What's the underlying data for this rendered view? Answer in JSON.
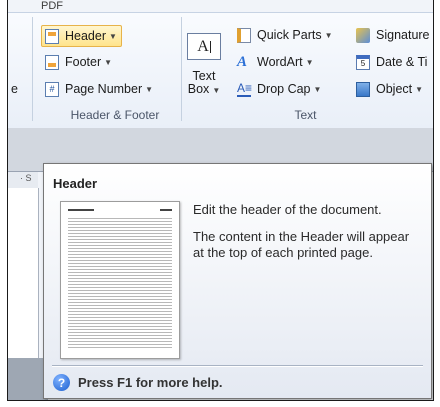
{
  "tabs": {
    "pdf": "PDF"
  },
  "left_cut": {
    "text": "e"
  },
  "header_footer_group": {
    "label": "Header & Footer",
    "header": "Header",
    "footer": "Footer",
    "page_number": "Page Number"
  },
  "text_group": {
    "label": "Text",
    "text_box_line1": "Text",
    "text_box_line2": "Box",
    "quick_parts": "Quick Parts",
    "wordart": "WordArt",
    "drop_cap": "Drop Cap",
    "signature": "Signature",
    "date_time": "Date & Ti",
    "object": "Object"
  },
  "ruler": {
    "marks": "· S"
  },
  "tooltip": {
    "title": "Header",
    "line1": "Edit the header of the document.",
    "line2": "The content in the Header will appear at the top of each printed page.",
    "help": "Press F1 for more help.",
    "help_icon_glyph": "?"
  },
  "colors": {
    "header_highlight": "#ffe48b",
    "help_blue": "#1c5fcf",
    "tooltip_border": "#767676"
  }
}
